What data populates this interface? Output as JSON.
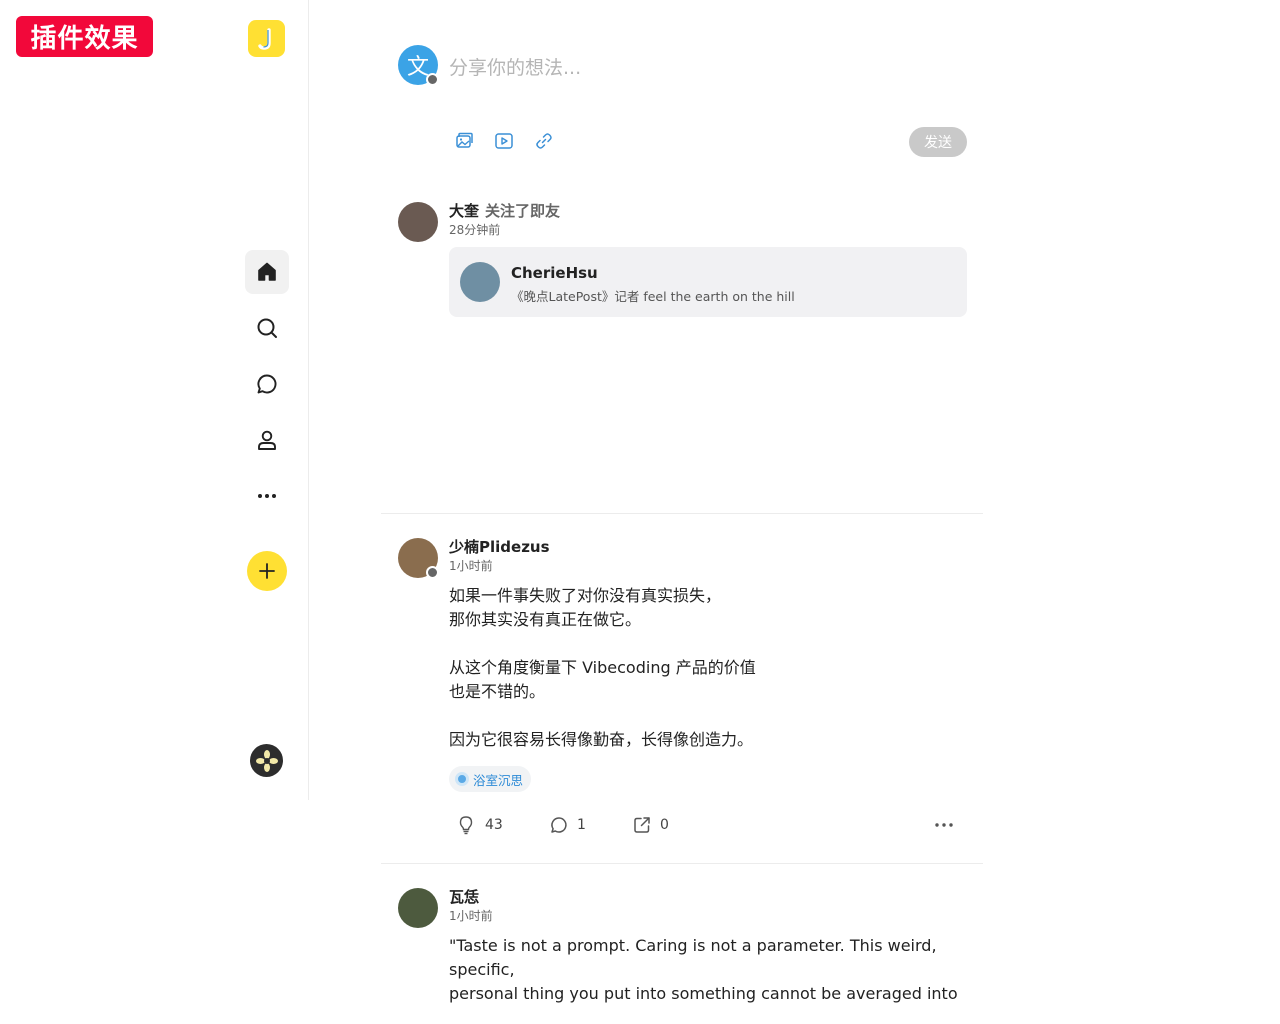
{
  "plugin_badge": "插件效果",
  "sidebar": {
    "logo_letter": "J",
    "nav": [
      {
        "name": "home",
        "icon": "home-icon",
        "active": true
      },
      {
        "name": "search",
        "icon": "search-icon"
      },
      {
        "name": "messages",
        "icon": "chat-bubble-icon"
      },
      {
        "name": "profile",
        "icon": "user-icon"
      },
      {
        "name": "more",
        "icon": "ellipsis-icon"
      }
    ],
    "fab_icon": "plus-icon",
    "accent": "#ffe033"
  },
  "composer": {
    "avatar_glyph": "文",
    "placeholder": "分享你的想法...",
    "tools": [
      "image-icon",
      "video-icon",
      "link-icon"
    ],
    "send_label": "发送"
  },
  "posts": [
    {
      "author": "大奎",
      "action": "关注了即友",
      "time": "28分钟前",
      "card": {
        "name": "CherieHsu",
        "bio": "《晚点LatePost》记者 feel the earth on the hill"
      }
    },
    {
      "author": "少楠Plidezus",
      "time": "1小时前",
      "lines": [
        "如果一件事失败了对你没有真实损失，",
        "那你其实没有真正在做它。",
        "",
        "从这个角度衡量下 Vibecoding 产品的价值",
        "也是不错的。",
        "",
        "因为它很容易长得像勤奋，长得像创造力。"
      ],
      "topic": "浴室沉思",
      "likes": "43",
      "comments": "1",
      "shares": "0"
    },
    {
      "author": "瓦恁",
      "time": "1小时前",
      "lines": [
        "\"Taste is not a prompt. Caring is not a parameter. This weird, specific,",
        "personal thing you put into something cannot be averaged into"
      ]
    }
  ]
}
